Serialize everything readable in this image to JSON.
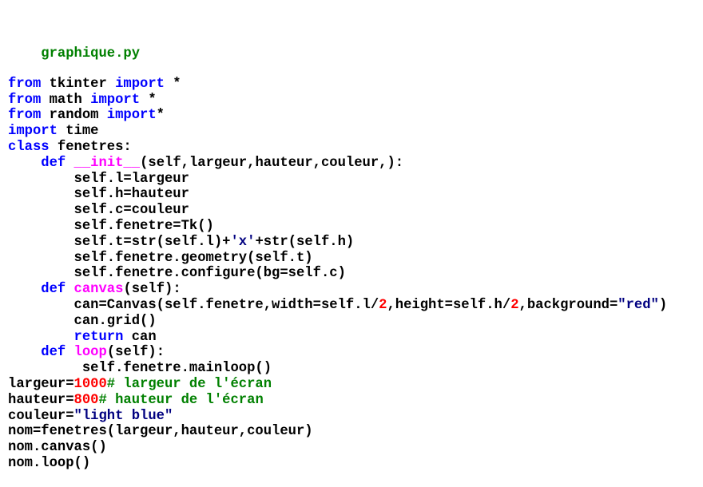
{
  "editor": {
    "filename": "graphique.py",
    "colors": {
      "kw": "#0000ff",
      "fn": "#ff00ff",
      "num": "#ff0000",
      "str": "#000080",
      "com": "#008000",
      "fname": "#008000",
      "plain": "#000000"
    },
    "lines": [
      [
        [
          "from",
          "kw"
        ],
        [
          " tkinter ",
          "plain"
        ],
        [
          "import",
          "kw"
        ],
        [
          " *",
          "plain"
        ]
      ],
      [
        [
          "from",
          "kw"
        ],
        [
          " math ",
          "plain"
        ],
        [
          "import",
          "kw"
        ],
        [
          " *",
          "plain"
        ]
      ],
      [
        [
          "from",
          "kw"
        ],
        [
          " random ",
          "plain"
        ],
        [
          "import",
          "kw"
        ],
        [
          "*",
          "plain"
        ]
      ],
      [
        [
          "import",
          "kw"
        ],
        [
          " time",
          "plain"
        ]
      ],
      [
        [
          "class",
          "kw"
        ],
        [
          " fenetres:",
          "plain"
        ]
      ],
      [
        [
          "    ",
          "plain"
        ],
        [
          "def",
          "kw"
        ],
        [
          " ",
          "plain"
        ],
        [
          "__init__",
          "fn"
        ],
        [
          "(self,largeur,hauteur,couleur,):",
          "plain"
        ]
      ],
      [
        [
          "        self.l=largeur",
          "plain"
        ]
      ],
      [
        [
          "        self.h=hauteur",
          "plain"
        ]
      ],
      [
        [
          "        self.c=couleur",
          "plain"
        ]
      ],
      [
        [
          "        self.fenetre=Tk()",
          "plain"
        ]
      ],
      [
        [
          "        self.t=str(self.l)+",
          "plain"
        ],
        [
          "'x'",
          "str"
        ],
        [
          "+str(self.h)",
          "plain"
        ]
      ],
      [
        [
          "        self.fenetre.geometry(self.t)",
          "plain"
        ]
      ],
      [
        [
          "        self.fenetre.configure(bg=self.c)",
          "plain"
        ]
      ],
      [
        [
          "    ",
          "plain"
        ],
        [
          "def",
          "kw"
        ],
        [
          " ",
          "plain"
        ],
        [
          "canvas",
          "fn"
        ],
        [
          "(self):",
          "plain"
        ]
      ],
      [
        [
          "        can=Canvas(self.fenetre,width=self.l/",
          "plain"
        ],
        [
          "2",
          "num"
        ],
        [
          ",height=self.h/",
          "plain"
        ],
        [
          "2",
          "num"
        ],
        [
          ",background=",
          "plain"
        ],
        [
          "\"red\"",
          "str"
        ],
        [
          ")",
          "plain"
        ]
      ],
      [
        [
          "        can.grid()",
          "plain"
        ]
      ],
      [
        [
          "        ",
          "plain"
        ],
        [
          "return",
          "kw"
        ],
        [
          " can",
          "plain"
        ]
      ],
      [
        [
          "    ",
          "plain"
        ],
        [
          "def",
          "kw"
        ],
        [
          " ",
          "plain"
        ],
        [
          "loop",
          "fn"
        ],
        [
          "(self):",
          "plain"
        ]
      ],
      [
        [
          "         self.fenetre.mainloop()",
          "plain"
        ]
      ],
      [
        [
          "largeur=",
          "plain"
        ],
        [
          "1000",
          "num"
        ],
        [
          "# largeur de l'écran",
          "com"
        ]
      ],
      [
        [
          "hauteur=",
          "plain"
        ],
        [
          "800",
          "num"
        ],
        [
          "# hauteur de l'écran",
          "com"
        ]
      ],
      [
        [
          "couleur=",
          "plain"
        ],
        [
          "\"light blue\"",
          "str"
        ]
      ],
      [
        [
          "nom=fenetres(largeur,hauteur,couleur)",
          "plain"
        ]
      ],
      [
        [
          "nom.canvas()",
          "plain"
        ]
      ],
      [
        [
          "nom.loop()",
          "plain"
        ]
      ]
    ]
  }
}
